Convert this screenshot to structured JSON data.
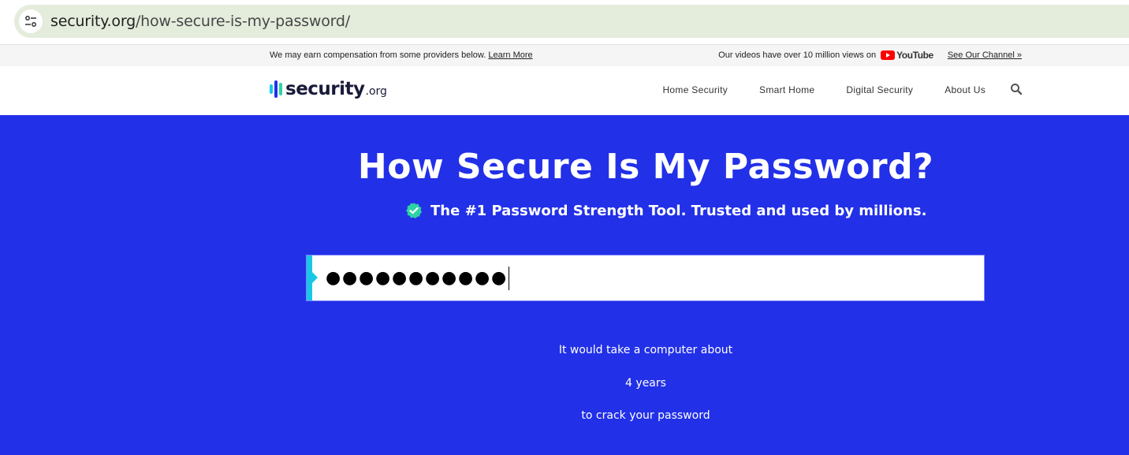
{
  "browser": {
    "url_domain": "security.org",
    "url_path": "/how-secure-is-my-password/"
  },
  "notice": {
    "text": "We may earn compensation from some providers below.",
    "learn_more": "Learn More",
    "videos_text": "Our videos have over 10 million views on",
    "youtube_label": "YouTube",
    "channel_link": "See Our Channel »"
  },
  "header": {
    "logo_main": "security",
    "logo_suffix": ".org",
    "nav": [
      "Home Security",
      "Smart Home",
      "Digital Security",
      "About Us"
    ]
  },
  "hero": {
    "title": "How Secure Is My Password?",
    "subtitle": "The #1 Password Strength Tool. Trusted and used by millions."
  },
  "password_input": {
    "masked_value": "●●●●●●●●●●●"
  },
  "result": {
    "line1": "It would take a computer about",
    "time": "4 years",
    "line3": "to crack your password"
  },
  "colors": {
    "hero_bg": "#2230e8",
    "accent": "#18c7e8",
    "check": "#2fd3a4"
  }
}
